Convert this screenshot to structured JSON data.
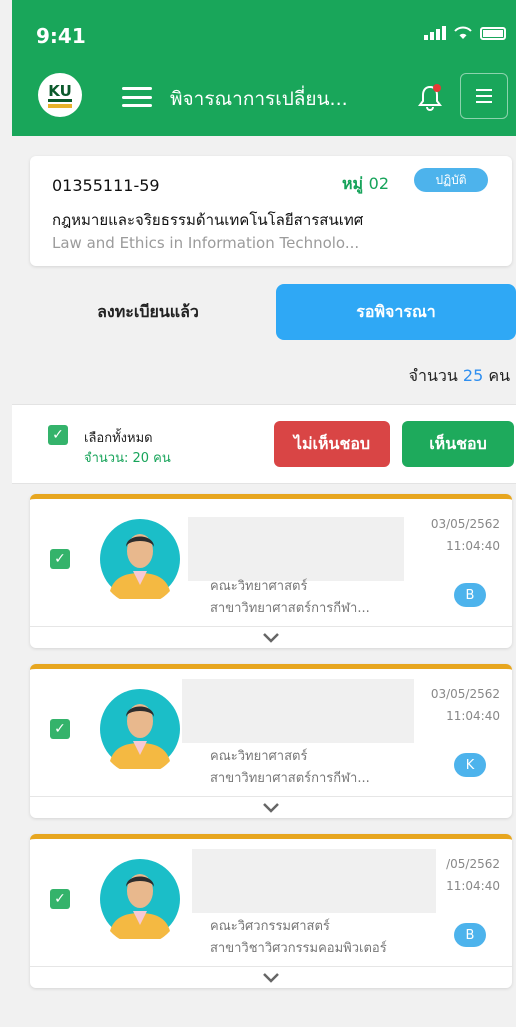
{
  "status_bar": {
    "time": "9:41"
  },
  "header": {
    "logo_text": "KU",
    "title": "พิจารณาการเปลี่ยน..."
  },
  "course": {
    "code": "01355111-59",
    "group_label": "หมู่",
    "group_number": "02",
    "type_badge": "ปฏิบัติ",
    "name_th": "กฎหมายและจริยธรรมด้านเทคโนโลยีสารสนเทศ",
    "name_en": "Law and Ethics in Information Technolo..."
  },
  "tabs": {
    "registered": "ลงทะเบียนแล้ว",
    "pending": "รอพิจารณา"
  },
  "total": {
    "prefix": "จำนวน",
    "count": "25",
    "suffix": "คน"
  },
  "select_bar": {
    "select_all": "เลือกทั้งหมด",
    "selected_count": "จำนวน: 20 คน",
    "reject_label": "ไม่เห็นชอบ",
    "approve_label": "เห็นชอบ"
  },
  "students": [
    {
      "faculty": "คณะวิทยาศาสตร์",
      "major": "สาขาวิทยาศาสตร์การกีฬา...",
      "date": "03/05/2562",
      "time": "11:04:40",
      "grade": "B"
    },
    {
      "faculty": "คณะวิทยาศาสตร์",
      "major": "สาขาวิทยาศาสตร์การกีฬา...",
      "date": "03/05/2562",
      "time": "11:04:40",
      "grade": "K"
    },
    {
      "faculty": "คณะวิศวกรรมศาสตร์",
      "major": "สาขาวิชาวิศวกรรมคอมพิวเตอร์",
      "date": "/05/2562",
      "time": "11:04:40",
      "grade": "B"
    }
  ],
  "colors": {
    "header_green": "#19a65a",
    "accent_blue": "#2fa8f5",
    "reject_red": "#d94545",
    "approve_green": "#1eaa5c",
    "card_top_border": "#e7a61f"
  }
}
